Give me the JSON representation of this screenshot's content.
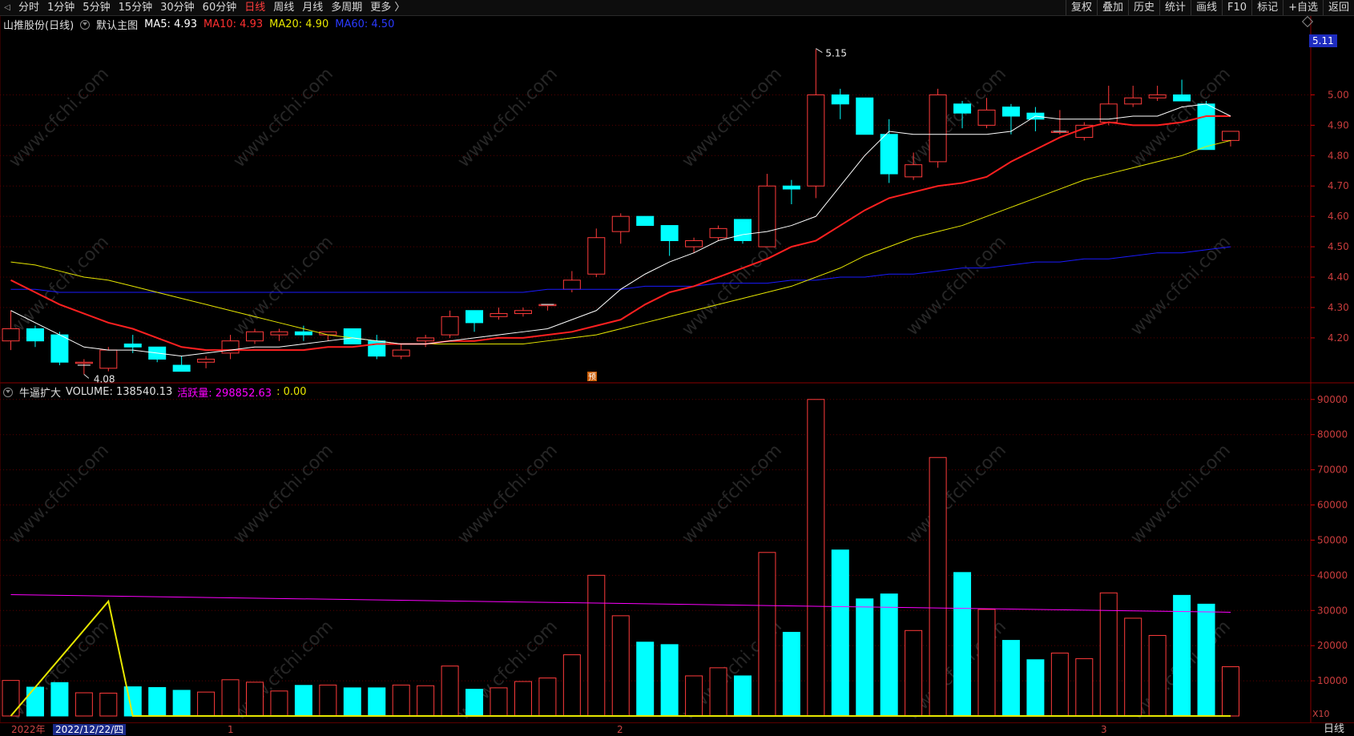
{
  "toolbar": {
    "periods": [
      "分时",
      "1分钟",
      "5分钟",
      "15分钟",
      "30分钟",
      "60分钟",
      "日线",
      "周线",
      "月线",
      "多周期",
      "更多 〉"
    ],
    "active_period": "日线",
    "right_buttons": [
      "复权",
      "叠加",
      "历史",
      "统计",
      "画线",
      "F10",
      "标记",
      "+自选",
      "返回"
    ]
  },
  "price_header": {
    "stock": "山推股份(日线)",
    "template": "默认主图",
    "ma5": "MA5: 4.93",
    "ma10": "MA10: 4.93",
    "ma20": "MA20: 4.90",
    "ma60": "MA60: 4.50"
  },
  "volume_header": {
    "name": "牛逼扩大",
    "volume": "VOLUME: 138540.13",
    "active": "活跃量: 298852.63",
    "extra": ": 0.00"
  },
  "price_tag": "5.11",
  "annotations": {
    "high": "5.15",
    "low": "4.08",
    "pre_mark": "预"
  },
  "bottom": {
    "year": "2022年",
    "cursor_date": "2022/12/22/四",
    "m1": "1",
    "m2": "2",
    "m3": "3",
    "freq": "日线",
    "x10": "X10"
  },
  "colors": {
    "up": "#ff3b3b",
    "down": "#00ffff",
    "ma5": "#ffffff",
    "ma10": "#ff2020",
    "ma20": "#e6e600",
    "ma60": "#1a1aff",
    "active": "#ff00ff",
    "bg": "#000000"
  },
  "chart_data": [
    {
      "type": "candlestick",
      "y_axis": [
        "5.00",
        "4.90",
        "4.80",
        "4.70",
        "4.60",
        "4.50",
        "4.40",
        "4.30",
        "4.20"
      ],
      "ylim": [
        4.06,
        5.22
      ],
      "candles": [
        {
          "o": 4.19,
          "h": 4.29,
          "l": 4.16,
          "c": 4.23
        },
        {
          "o": 4.23,
          "h": 4.24,
          "l": 4.17,
          "c": 4.19
        },
        {
          "o": 4.21,
          "h": 4.22,
          "l": 4.11,
          "c": 4.12
        },
        {
          "o": 4.12,
          "h": 4.13,
          "l": 4.08,
          "c": 4.12
        },
        {
          "o": 4.1,
          "h": 4.17,
          "l": 4.09,
          "c": 4.16
        },
        {
          "o": 4.18,
          "h": 4.21,
          "l": 4.15,
          "c": 4.17
        },
        {
          "o": 4.17,
          "h": 4.17,
          "l": 4.12,
          "c": 4.13
        },
        {
          "o": 4.11,
          "h": 4.14,
          "l": 4.1,
          "c": 4.09
        },
        {
          "o": 4.12,
          "h": 4.14,
          "l": 4.1,
          "c": 4.13
        },
        {
          "o": 4.15,
          "h": 4.21,
          "l": 4.13,
          "c": 4.19
        },
        {
          "o": 4.19,
          "h": 4.23,
          "l": 4.18,
          "c": 4.22
        },
        {
          "o": 4.21,
          "h": 4.23,
          "l": 4.19,
          "c": 4.22
        },
        {
          "o": 4.22,
          "h": 4.24,
          "l": 4.19,
          "c": 4.21
        },
        {
          "o": 4.21,
          "h": 4.22,
          "l": 4.19,
          "c": 4.22
        },
        {
          "o": 4.23,
          "h": 4.23,
          "l": 4.18,
          "c": 4.18
        },
        {
          "o": 4.19,
          "h": 4.21,
          "l": 4.13,
          "c": 4.14
        },
        {
          "o": 4.14,
          "h": 4.18,
          "l": 4.13,
          "c": 4.16
        },
        {
          "o": 4.19,
          "h": 4.21,
          "l": 4.17,
          "c": 4.2
        },
        {
          "o": 4.21,
          "h": 4.29,
          "l": 4.2,
          "c": 4.27
        },
        {
          "o": 4.29,
          "h": 4.29,
          "l": 4.22,
          "c": 4.25
        },
        {
          "o": 4.27,
          "h": 4.3,
          "l": 4.26,
          "c": 4.28
        },
        {
          "o": 4.28,
          "h": 4.3,
          "l": 4.27,
          "c": 4.29
        },
        {
          "o": 4.31,
          "h": 4.31,
          "l": 4.29,
          "c": 4.31
        },
        {
          "o": 4.36,
          "h": 4.42,
          "l": 4.35,
          "c": 4.39
        },
        {
          "o": 4.41,
          "h": 4.56,
          "l": 4.4,
          "c": 4.53
        },
        {
          "o": 4.55,
          "h": 4.61,
          "l": 4.51,
          "c": 4.6
        },
        {
          "o": 4.6,
          "h": 4.6,
          "l": 4.57,
          "c": 4.57
        },
        {
          "o": 4.57,
          "h": 4.57,
          "l": 4.47,
          "c": 4.52
        },
        {
          "o": 4.5,
          "h": 4.53,
          "l": 4.48,
          "c": 4.52
        },
        {
          "o": 4.53,
          "h": 4.57,
          "l": 4.52,
          "c": 4.56
        },
        {
          "o": 4.59,
          "h": 4.59,
          "l": 4.51,
          "c": 4.52
        },
        {
          "o": 4.5,
          "h": 4.74,
          "l": 4.5,
          "c": 4.7
        },
        {
          "o": 4.7,
          "h": 4.72,
          "l": 4.64,
          "c": 4.69
        },
        {
          "o": 4.7,
          "h": 5.15,
          "l": 4.66,
          "c": 5.0
        },
        {
          "o": 5.0,
          "h": 5.02,
          "l": 4.92,
          "c": 4.97
        },
        {
          "o": 4.99,
          "h": 4.99,
          "l": 4.87,
          "c": 4.87
        },
        {
          "o": 4.87,
          "h": 4.92,
          "l": 4.71,
          "c": 4.74
        },
        {
          "o": 4.73,
          "h": 4.81,
          "l": 4.72,
          "c": 4.77
        },
        {
          "o": 4.78,
          "h": 5.02,
          "l": 4.76,
          "c": 5.0
        },
        {
          "o": 4.97,
          "h": 4.98,
          "l": 4.89,
          "c": 4.94
        },
        {
          "o": 4.9,
          "h": 4.99,
          "l": 4.89,
          "c": 4.95
        },
        {
          "o": 4.96,
          "h": 4.97,
          "l": 4.87,
          "c": 4.93
        },
        {
          "o": 4.94,
          "h": 4.96,
          "l": 4.88,
          "c": 4.92
        },
        {
          "o": 4.88,
          "h": 4.95,
          "l": 4.87,
          "c": 4.88
        },
        {
          "o": 4.86,
          "h": 4.91,
          "l": 4.85,
          "c": 4.9
        },
        {
          "o": 4.91,
          "h": 5.03,
          "l": 4.9,
          "c": 4.97
        },
        {
          "o": 4.97,
          "h": 5.03,
          "l": 4.96,
          "c": 4.99
        },
        {
          "o": 4.99,
          "h": 5.03,
          "l": 4.98,
          "c": 5.0
        },
        {
          "o": 5.0,
          "h": 5.05,
          "l": 4.98,
          "c": 4.98
        },
        {
          "o": 4.97,
          "h": 4.98,
          "l": 4.82,
          "c": 4.82
        },
        {
          "o": 4.85,
          "h": 4.88,
          "l": 4.83,
          "c": 4.88
        }
      ],
      "ma5": [
        4.29,
        4.25,
        4.21,
        4.17,
        4.16,
        4.16,
        4.15,
        4.14,
        4.15,
        4.16,
        4.17,
        4.17,
        4.18,
        4.19,
        4.2,
        4.19,
        4.18,
        4.18,
        4.19,
        4.2,
        4.21,
        4.22,
        4.23,
        4.26,
        4.29,
        4.36,
        4.41,
        4.45,
        4.48,
        4.52,
        4.54,
        4.55,
        4.57,
        4.6,
        4.7,
        4.8,
        4.88,
        4.87,
        4.87,
        4.87,
        4.87,
        4.88,
        4.93,
        4.92,
        4.92,
        4.92,
        4.93,
        4.93,
        4.96,
        4.97,
        4.93
      ],
      "ma10": [
        4.39,
        4.35,
        4.31,
        4.28,
        4.25,
        4.23,
        4.2,
        4.17,
        4.16,
        4.16,
        4.16,
        4.16,
        4.16,
        4.17,
        4.17,
        4.18,
        4.18,
        4.18,
        4.19,
        4.19,
        4.2,
        4.2,
        4.21,
        4.22,
        4.24,
        4.26,
        4.31,
        4.35,
        4.37,
        4.4,
        4.43,
        4.46,
        4.5,
        4.52,
        4.57,
        4.62,
        4.66,
        4.68,
        4.7,
        4.71,
        4.73,
        4.78,
        4.82,
        4.86,
        4.89,
        4.91,
        4.9,
        4.9,
        4.91,
        4.93,
        4.93
      ],
      "ma20": [
        4.45,
        4.44,
        4.42,
        4.4,
        4.39,
        4.37,
        4.35,
        4.33,
        4.31,
        4.29,
        4.27,
        4.25,
        4.23,
        4.21,
        4.2,
        4.19,
        4.18,
        4.18,
        4.18,
        4.18,
        4.18,
        4.18,
        4.19,
        4.2,
        4.21,
        4.23,
        4.25,
        4.27,
        4.29,
        4.31,
        4.33,
        4.35,
        4.37,
        4.4,
        4.43,
        4.47,
        4.5,
        4.53,
        4.55,
        4.57,
        4.6,
        4.63,
        4.66,
        4.69,
        4.72,
        4.74,
        4.76,
        4.78,
        4.8,
        4.83,
        4.85,
        4.87,
        4.88,
        4.9
      ],
      "ma60": [
        4.36,
        4.36,
        4.35,
        4.35,
        4.35,
        4.35,
        4.35,
        4.35,
        4.35,
        4.35,
        4.35,
        4.35,
        4.35,
        4.35,
        4.35,
        4.35,
        4.35,
        4.35,
        4.35,
        4.35,
        4.35,
        4.35,
        4.36,
        4.36,
        4.36,
        4.36,
        4.37,
        4.37,
        4.37,
        4.38,
        4.38,
        4.38,
        4.39,
        4.39,
        4.4,
        4.4,
        4.41,
        4.41,
        4.42,
        4.43,
        4.43,
        4.44,
        4.45,
        4.45,
        4.46,
        4.46,
        4.47,
        4.48,
        4.48,
        4.49,
        4.5
      ]
    },
    {
      "type": "bar",
      "y_axis": [
        "90000",
        "80000",
        "70000",
        "60000",
        "50000",
        "40000",
        "30000",
        "20000",
        "10000"
      ],
      "ylim": [
        0,
        92000
      ],
      "volume": [
        10100,
        8200,
        9500,
        6600,
        6500,
        8300,
        8100,
        7300,
        6800,
        10300,
        9600,
        7100,
        8700,
        8800,
        8000,
        8000,
        8800,
        8600,
        14200,
        7600,
        8000,
        9800,
        10800,
        17400,
        40000,
        28500,
        21000,
        20300,
        11400,
        13700,
        11400,
        46500,
        23800,
        90000,
        47200,
        33300,
        34700,
        24300,
        73500,
        40800,
        30300,
        21500,
        16000,
        17900,
        16300,
        35000,
        27800,
        22900,
        34300,
        31800,
        14000
      ],
      "active_line": [
        34500,
        29500
      ],
      "spike_line": [
        [
          0,
          0
        ],
        [
          4,
          32600
        ],
        [
          5,
          0
        ],
        [
          50,
          0
        ]
      ]
    }
  ]
}
